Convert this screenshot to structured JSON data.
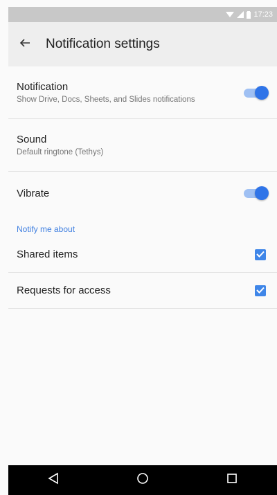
{
  "status_bar": {
    "time": "17:23"
  },
  "app_bar": {
    "title": "Notification settings"
  },
  "settings": {
    "notification": {
      "title": "Notification",
      "subtitle": "Show Drive, Docs, Sheets, and Slides notifications",
      "enabled": true
    },
    "sound": {
      "title": "Sound",
      "subtitle": "Default ringtone (Tethys)"
    },
    "vibrate": {
      "title": "Vibrate",
      "enabled": true
    }
  },
  "notify_section": {
    "header": "Notify me about",
    "items": [
      {
        "label": "Shared items",
        "checked": true
      },
      {
        "label": "Requests for access",
        "checked": true
      }
    ]
  },
  "colors": {
    "accent": "#2f74e8",
    "section_header": "#3f7fe0",
    "app_bar": "#eeeeee",
    "status_bar": "#c8c8c8",
    "nav_bar": "#000000"
  }
}
